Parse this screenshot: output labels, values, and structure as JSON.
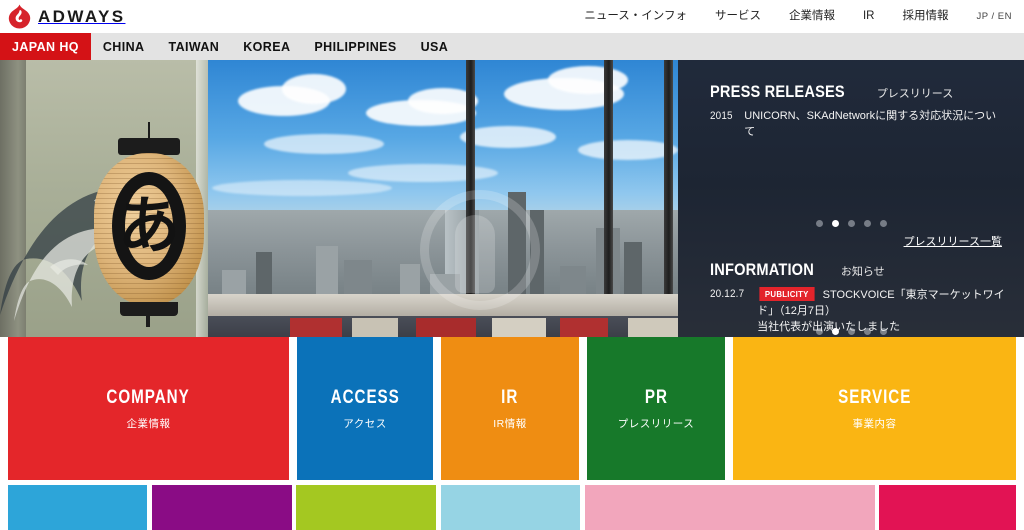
{
  "brand": {
    "name": "ADWAYS",
    "logo_color": "#d6232b"
  },
  "global_nav": [
    {
      "label": "ニュース・インフォ"
    },
    {
      "label": "サービス"
    },
    {
      "label": "企業情報"
    },
    {
      "label": "IR"
    },
    {
      "label": "採用情報"
    },
    {
      "label": "JP / EN"
    }
  ],
  "region_nav": {
    "active_color": "#d41216",
    "bar_color": "#e3e3e3",
    "items": [
      {
        "label": "JAPAN HQ",
        "active": true
      },
      {
        "label": "CHINA",
        "active": false
      },
      {
        "label": "TAIWAN",
        "active": false
      },
      {
        "label": "KOREA",
        "active": false
      },
      {
        "label": "PHILIPPINES",
        "active": false
      },
      {
        "label": "USA",
        "active": false
      }
    ]
  },
  "hero": {
    "lantern_character": "あ"
  },
  "news_panel": {
    "press": {
      "title_en": "PRESS RELEASES",
      "title_jp": "プレスリリース",
      "item": {
        "date": "2015",
        "text": "UNICORN、SKAdNetworkに関する対応状況について"
      },
      "dots": {
        "count": 5,
        "active_index": 1
      },
      "more_label": "プレスリリース一覧"
    },
    "information": {
      "title_en": "INFORMATION",
      "title_jp": "お知らせ",
      "item": {
        "date": "20.12.7",
        "tag": "PUBLICITY",
        "tag_color": "#e3242b",
        "text": "STOCKVOICE「東京マーケットワイド」（12月7日）",
        "text2": "当社代表が出演いたしました"
      },
      "dots": {
        "count": 5,
        "active_index": 1
      }
    }
  },
  "tiles_primary": [
    {
      "en": "COMPANY",
      "jp": "企業情報",
      "color": "#e4262a"
    },
    {
      "en": "ACCESS",
      "jp": "アクセス",
      "color": "#0b72b9"
    },
    {
      "en": "IR",
      "jp": "IR情報",
      "color": "#ef8d12"
    },
    {
      "en": "PR",
      "jp": "プレスリリース",
      "color": "#17792a"
    },
    {
      "en": "SERVICE",
      "jp": "事業内容",
      "color": "#fab513"
    }
  ],
  "tiles_secondary": [
    {
      "color": "#2da5d9"
    },
    {
      "color": "#8a0c85"
    },
    {
      "color": "#a4c821"
    },
    {
      "color": "#96d4e4"
    },
    {
      "color": "#f2a6bc"
    },
    {
      "color": "#e21354"
    }
  ]
}
